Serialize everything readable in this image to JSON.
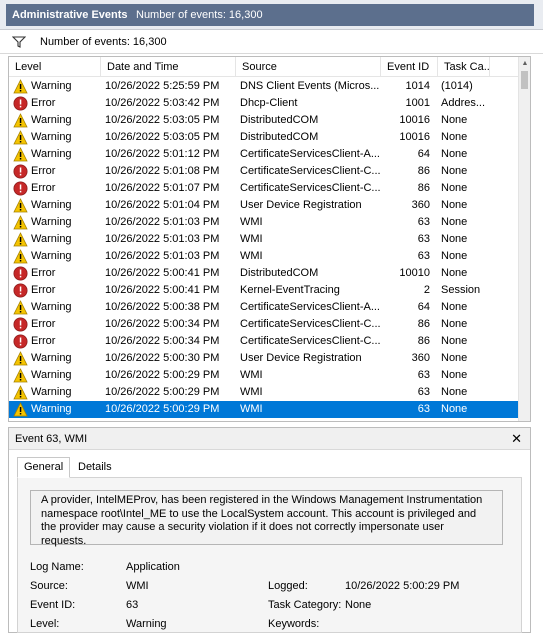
{
  "titlebar": {
    "title": "Administrative Events",
    "count": "Number of events: 16,300"
  },
  "filter": {
    "icon": "filter-icon",
    "text": "Number of events: 16,300"
  },
  "columns": [
    "Level",
    "Date and Time",
    "Source",
    "Event ID",
    "Task Ca..."
  ],
  "rows": [
    {
      "level": "Warning",
      "date": "10/26/2022 5:25:59 PM",
      "source": "DNS Client Events (Micros...",
      "id": "1014",
      "cat": "(1014)"
    },
    {
      "level": "Error",
      "date": "10/26/2022 5:03:42 PM",
      "source": "Dhcp-Client",
      "id": "1001",
      "cat": "Addres..."
    },
    {
      "level": "Warning",
      "date": "10/26/2022 5:03:05 PM",
      "source": "DistributedCOM",
      "id": "10016",
      "cat": "None"
    },
    {
      "level": "Warning",
      "date": "10/26/2022 5:03:05 PM",
      "source": "DistributedCOM",
      "id": "10016",
      "cat": "None"
    },
    {
      "level": "Warning",
      "date": "10/26/2022 5:01:12 PM",
      "source": "CertificateServicesClient-A...",
      "id": "64",
      "cat": "None"
    },
    {
      "level": "Error",
      "date": "10/26/2022 5:01:08 PM",
      "source": "CertificateServicesClient-C...",
      "id": "86",
      "cat": "None"
    },
    {
      "level": "Error",
      "date": "10/26/2022 5:01:07 PM",
      "source": "CertificateServicesClient-C...",
      "id": "86",
      "cat": "None"
    },
    {
      "level": "Warning",
      "date": "10/26/2022 5:01:04 PM",
      "source": "User Device Registration",
      "id": "360",
      "cat": "None"
    },
    {
      "level": "Warning",
      "date": "10/26/2022 5:01:03 PM",
      "source": "WMI",
      "id": "63",
      "cat": "None"
    },
    {
      "level": "Warning",
      "date": "10/26/2022 5:01:03 PM",
      "source": "WMI",
      "id": "63",
      "cat": "None"
    },
    {
      "level": "Warning",
      "date": "10/26/2022 5:01:03 PM",
      "source": "WMI",
      "id": "63",
      "cat": "None"
    },
    {
      "level": "Error",
      "date": "10/26/2022 5:00:41 PM",
      "source": "DistributedCOM",
      "id": "10010",
      "cat": "None"
    },
    {
      "level": "Error",
      "date": "10/26/2022 5:00:41 PM",
      "source": "Kernel-EventTracing",
      "id": "2",
      "cat": "Session"
    },
    {
      "level": "Warning",
      "date": "10/26/2022 5:00:38 PM",
      "source": "CertificateServicesClient-A...",
      "id": "64",
      "cat": "None"
    },
    {
      "level": "Error",
      "date": "10/26/2022 5:00:34 PM",
      "source": "CertificateServicesClient-C...",
      "id": "86",
      "cat": "None"
    },
    {
      "level": "Error",
      "date": "10/26/2022 5:00:34 PM",
      "source": "CertificateServicesClient-C...",
      "id": "86",
      "cat": "None"
    },
    {
      "level": "Warning",
      "date": "10/26/2022 5:00:30 PM",
      "source": "User Device Registration",
      "id": "360",
      "cat": "None"
    },
    {
      "level": "Warning",
      "date": "10/26/2022 5:00:29 PM",
      "source": "WMI",
      "id": "63",
      "cat": "None"
    },
    {
      "level": "Warning",
      "date": "10/26/2022 5:00:29 PM",
      "source": "WMI",
      "id": "63",
      "cat": "None"
    },
    {
      "level": "Warning",
      "date": "10/26/2022 5:00:29 PM",
      "source": "WMI",
      "id": "63",
      "cat": "None",
      "selected": true
    }
  ],
  "detail": {
    "title": "Event 63, WMI",
    "close": "✕",
    "tabs": [
      "General",
      "Details"
    ],
    "active_tab": "General",
    "description": "A provider, IntelMEProv, has been registered in the Windows Management Instrumentation namespace root\\Intel_ME to use the LocalSystem account. This account is privileged and the provider may cause a security violation if it does not correctly impersonate user requests.",
    "props": {
      "log_name_label": "Log Name:",
      "log_name": "Application",
      "source_label": "Source:",
      "source": "WMI",
      "logged_label": "Logged:",
      "logged": "10/26/2022 5:00:29 PM",
      "event_id_label": "Event ID:",
      "event_id": "63",
      "task_cat_label": "Task Category:",
      "task_cat": "None",
      "level_label": "Level:",
      "level": "Warning",
      "keywords_label": "Keywords:",
      "keywords": ""
    }
  },
  "colors": {
    "title_strip": "#5c6f8d",
    "selection": "#0078d7",
    "warning": "#f5c400",
    "error": "#c62828"
  }
}
